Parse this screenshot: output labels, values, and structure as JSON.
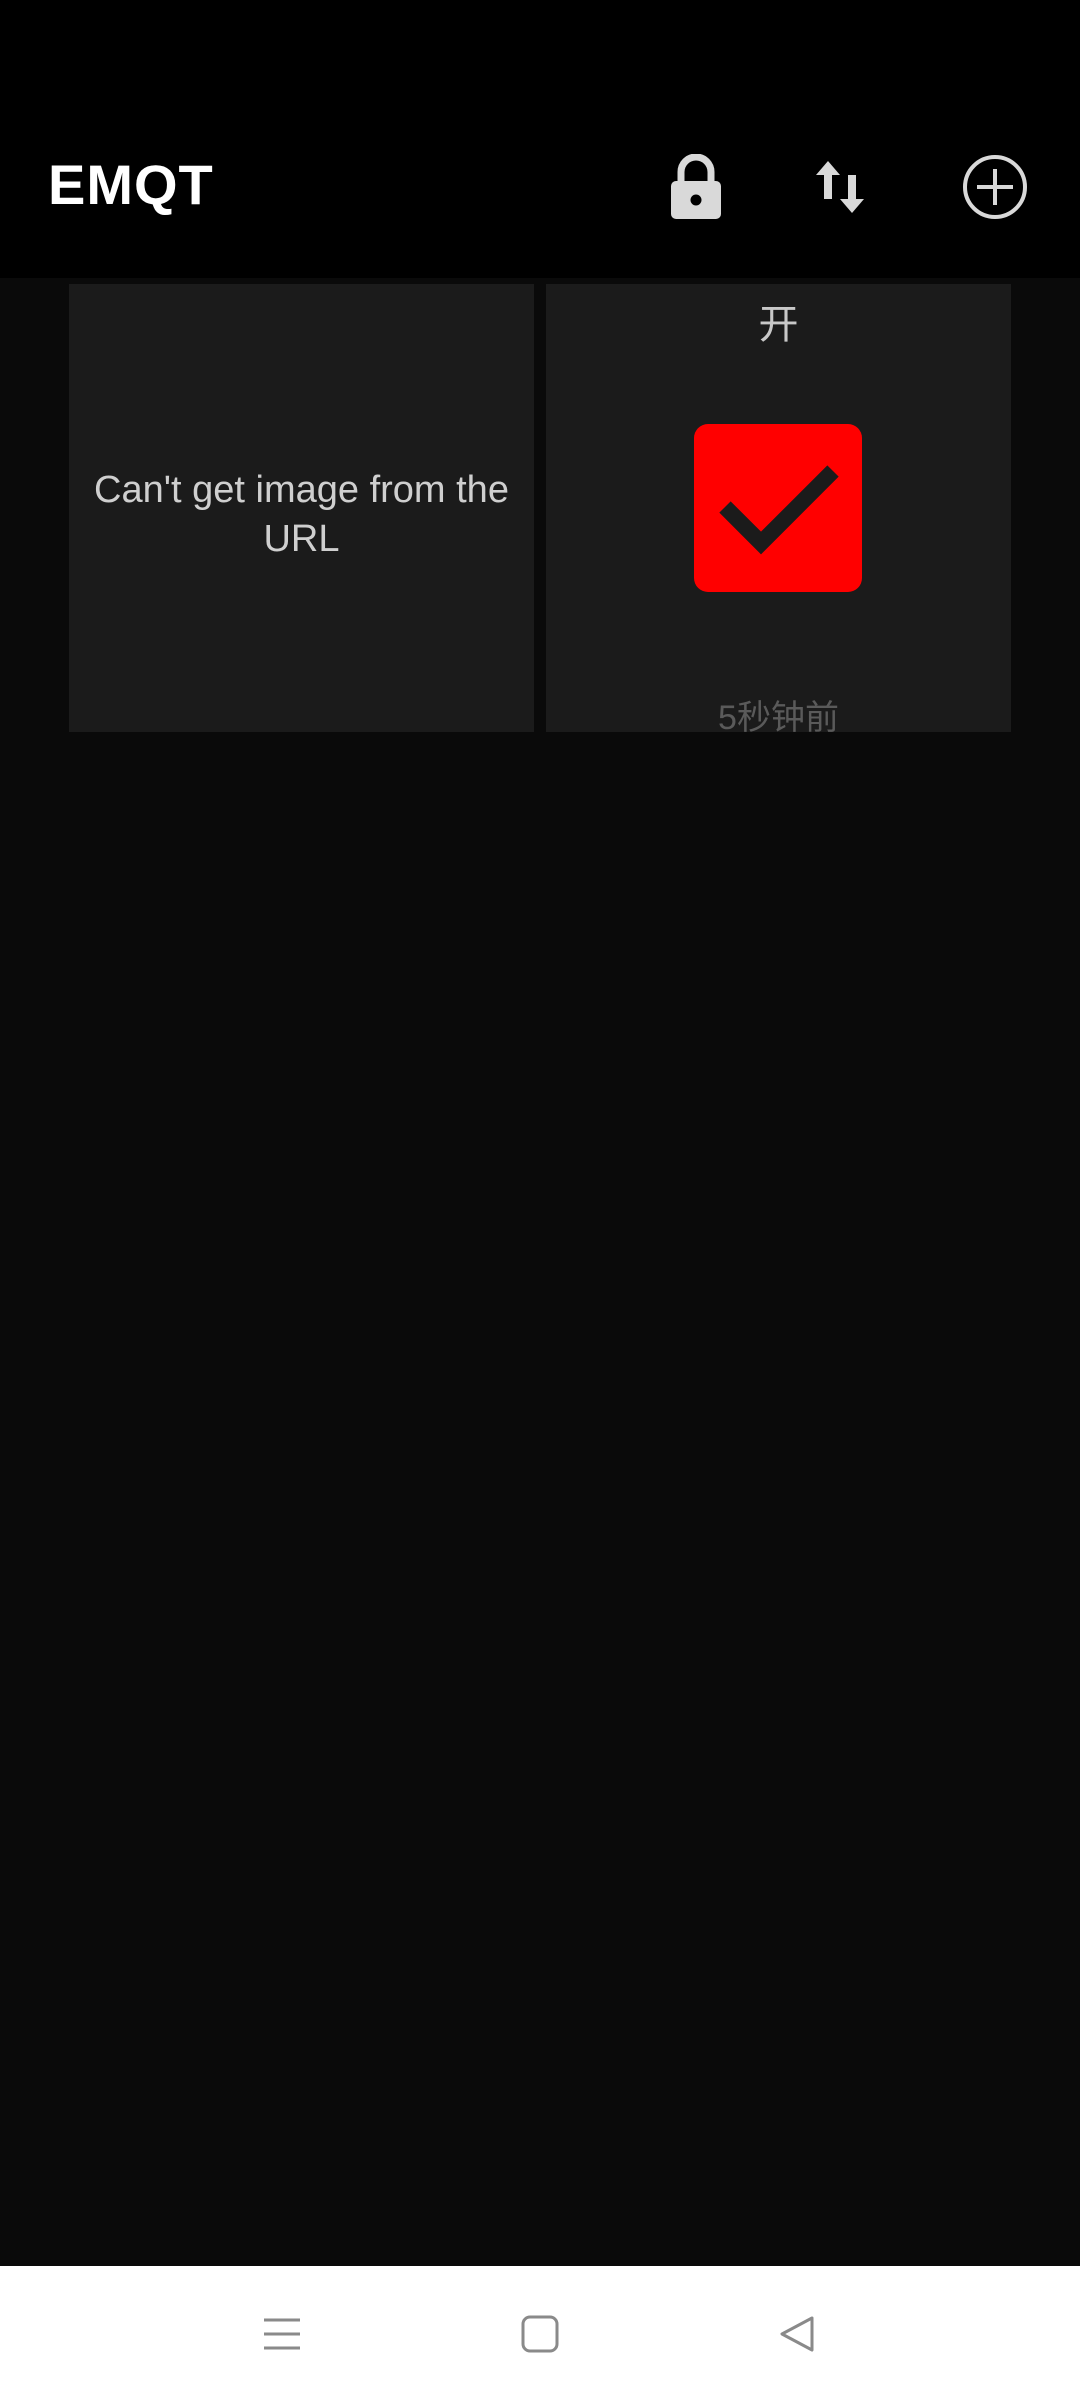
{
  "app": {
    "title": "EMQT"
  },
  "toolbar": {
    "lock_icon": "lock-icon",
    "sort_icon": "swap-vertical-icon",
    "add_icon": "add-circle-icon"
  },
  "tiles": [
    {
      "type": "image",
      "message": "Can't get image from the URL"
    },
    {
      "type": "switch",
      "title": "开",
      "state": "on",
      "icon": "checkbox-checked-icon",
      "color": "#ff0000",
      "updated": "5秒钟前"
    }
  ],
  "navigation": {
    "menu_icon": "menu-icon",
    "home_icon": "home-icon",
    "back_icon": "back-icon"
  },
  "colors": {
    "background": "#0a0a0a",
    "app_bar": "#000000",
    "tile": "#1b1b1b",
    "accent": "#ff0000"
  }
}
